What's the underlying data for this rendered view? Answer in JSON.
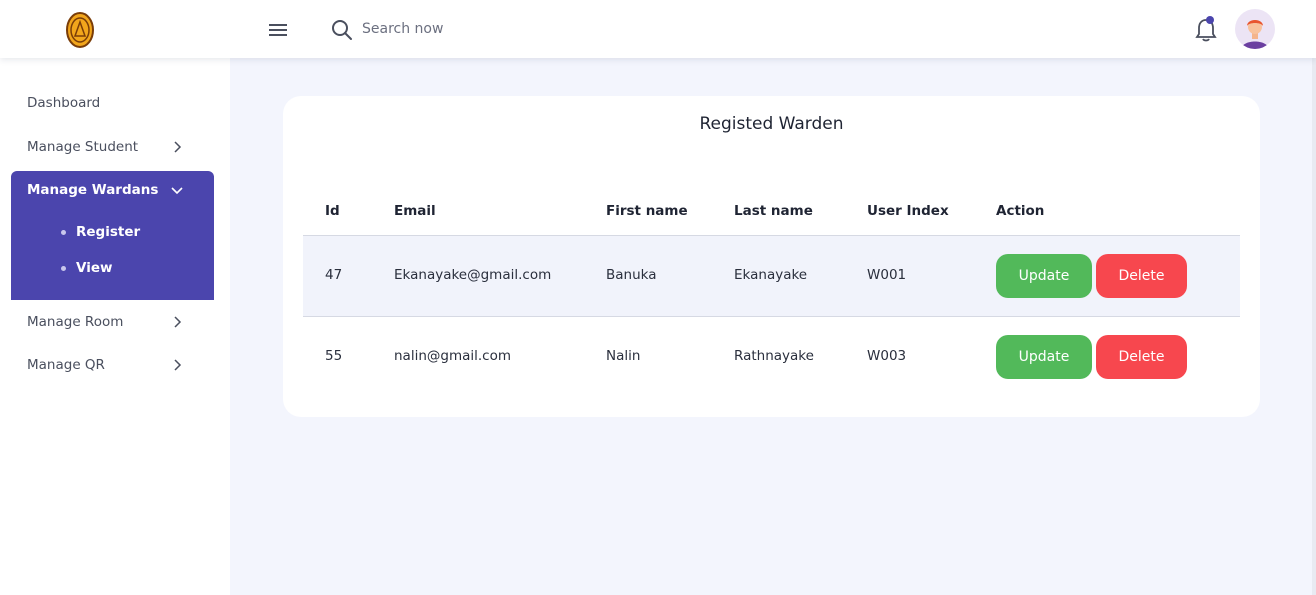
{
  "header": {
    "search_placeholder": "Search now"
  },
  "sidebar": {
    "items": [
      {
        "label": "Dashboard"
      },
      {
        "label": "Manage Student"
      },
      {
        "label": "Manage Wardans",
        "expanded": true,
        "children": [
          {
            "label": "Register"
          },
          {
            "label": "View"
          }
        ]
      },
      {
        "label": "Manage Room"
      },
      {
        "label": "Manage QR"
      }
    ]
  },
  "main": {
    "title": "Registed Warden",
    "columns": [
      "Id",
      "Email",
      "First name",
      "Last name",
      "User Index",
      "Action"
    ],
    "rows": [
      {
        "id": "47",
        "email": "Ekanayake@gmail.com",
        "first": "Banuka",
        "last": "Ekanayake",
        "index": "W001"
      },
      {
        "id": "55",
        "email": "nalin@gmail.com",
        "first": "Nalin",
        "last": "Rathnayake",
        "index": "W003"
      }
    ],
    "update_label": "Update",
    "delete_label": "Delete"
  },
  "colors": {
    "accent": "#4b45ad",
    "update": "#52b95a",
    "delete": "#f7474e",
    "background": "#f3f5fd"
  }
}
